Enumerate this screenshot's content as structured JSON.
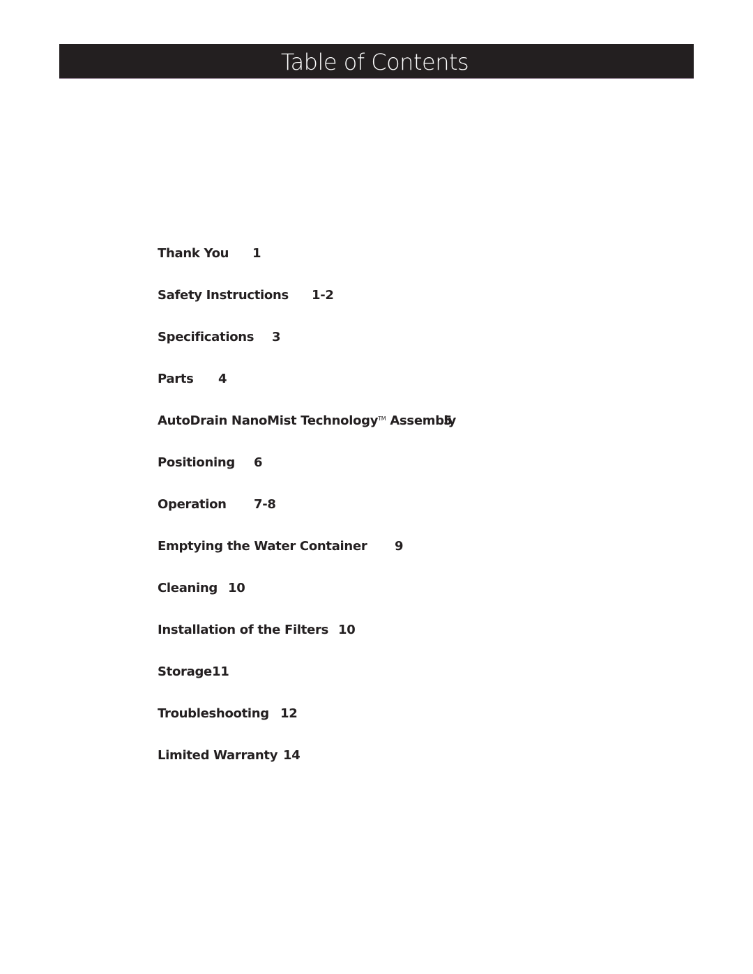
{
  "header": {
    "title": "Table of Contents",
    "bar_color": "#231f20"
  },
  "toc": {
    "entries": [
      {
        "title": "Thank You",
        "page": "1"
      },
      {
        "title": "Safety Instructions",
        "page": "1-2"
      },
      {
        "title": "Specifications",
        "page": "3"
      },
      {
        "title": "Parts",
        "page": "4"
      },
      {
        "title": "AutoDrain NanoMist Technology",
        "trademark": "TM",
        "title_suffix": "Assembly",
        "page": "5"
      },
      {
        "title": "Positioning",
        "page": "6"
      },
      {
        "title": "Operation",
        "page": "7-8"
      },
      {
        "title": "Emptying the Water Container",
        "page": "9"
      },
      {
        "title": "Cleaning",
        "page": "10"
      },
      {
        "title": "Installation of the Filters",
        "page": "10"
      },
      {
        "title": "Storage",
        "page": "11"
      },
      {
        "title": "Troubleshooting",
        "page": "12"
      },
      {
        "title": "Limited Warranty",
        "page": "14"
      }
    ]
  }
}
